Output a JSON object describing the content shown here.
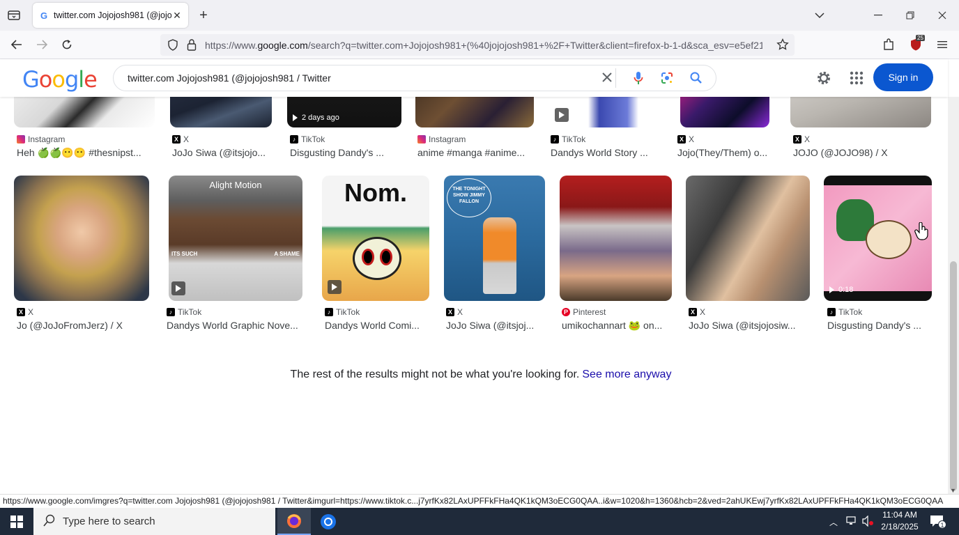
{
  "browser": {
    "tab_title": "twitter.com Jojojosh981 (@jojoj",
    "url_prefix": "https://www.",
    "url_domain": "google.com",
    "url_rest": "/search?q=twitter.com+Jojojosh981+(%40jojojosh981+%2F+Twitter&client=firefox-b-1-d&sca_esv=e5ef21",
    "extension_badge": "25"
  },
  "google": {
    "logo": "Google",
    "search_value": "twitter.com Jojojosh981 (@jojojosh981 / Twitter",
    "signin_label": "Sign in"
  },
  "row1": [
    {
      "source": "Instagram",
      "source_icon": "instagram-icon",
      "caption": "Heh 🍏🍏😶😶 #thesnipst..."
    },
    {
      "source": "X",
      "source_icon": "x-icon",
      "caption": "JoJo Siwa (@itsjojo..."
    },
    {
      "source": "TikTok",
      "source_icon": "tiktok-icon",
      "caption": "Disgusting Dandy's ...",
      "badge": "2 days ago"
    },
    {
      "source": "Instagram",
      "source_icon": "instagram-icon",
      "caption": "anime #manga #anime..."
    },
    {
      "source": "TikTok",
      "source_icon": "tiktok-icon",
      "caption": "Dandys World Story ..."
    },
    {
      "source": "X",
      "source_icon": "x-icon",
      "caption": "Jojo(They/Them) o..."
    },
    {
      "source": "X",
      "source_icon": "x-icon",
      "caption": "JOJO (@JOJO98) / X"
    }
  ],
  "row2": [
    {
      "source": "X",
      "source_icon": "x-icon",
      "caption": "Jo (@JoJoFromJerz) / X"
    },
    {
      "source": "TikTok",
      "source_icon": "tiktok-icon",
      "caption": "Dandys World Graphic Nove...",
      "overlay_top": "Alight Motion",
      "overlay_left": "ITS SUCH",
      "overlay_right": "A SHAME"
    },
    {
      "source": "TikTok",
      "source_icon": "tiktok-icon",
      "caption": "Dandys World Comi...",
      "overlay_top": "Nom."
    },
    {
      "source": "X",
      "source_icon": "x-icon",
      "caption": "JoJo Siwa (@itsjoj...",
      "overlay_top": "THE TONIGHT SHOW JIMMY FALLON"
    },
    {
      "source": "Pinterest",
      "source_icon": "pinterest-icon",
      "caption": "umikochannart 🐸 on..."
    },
    {
      "source": "X",
      "source_icon": "x-icon",
      "caption": "JoJo Siwa (@itsjojosiw..."
    },
    {
      "source": "TikTok",
      "source_icon": "tiktok-icon",
      "caption": "Disgusting Dandy's ...",
      "badge": "0:18"
    }
  ],
  "rest_message": "The rest of the results might not be what you're looking for.",
  "see_more": "See more anyway",
  "status_url": "https://www.google.com/imgres?q=twitter.com Jojojosh981 (@jojojosh981 / Twitter&imgurl=https://www.tiktok.c...j7yrfKx82LAxUPFFkFHa4QK1kQM3oECG0QAA..i&w=1020&h=1360&hcb=2&ved=2ahUKEwj7yrfKx82LAxUPFFkFHa4QK1kQM3oECG0QAA",
  "taskbar": {
    "search_placeholder": "Type here to search",
    "time": "11:04 AM",
    "date": "2/18/2025",
    "notification_count": "1"
  },
  "colors": {
    "google_blue": "#4285f4",
    "google_red": "#ea4335",
    "google_yellow": "#fbbc05",
    "google_green": "#34a853",
    "signin_bg": "#0b57d0",
    "link": "#1a0dab"
  }
}
